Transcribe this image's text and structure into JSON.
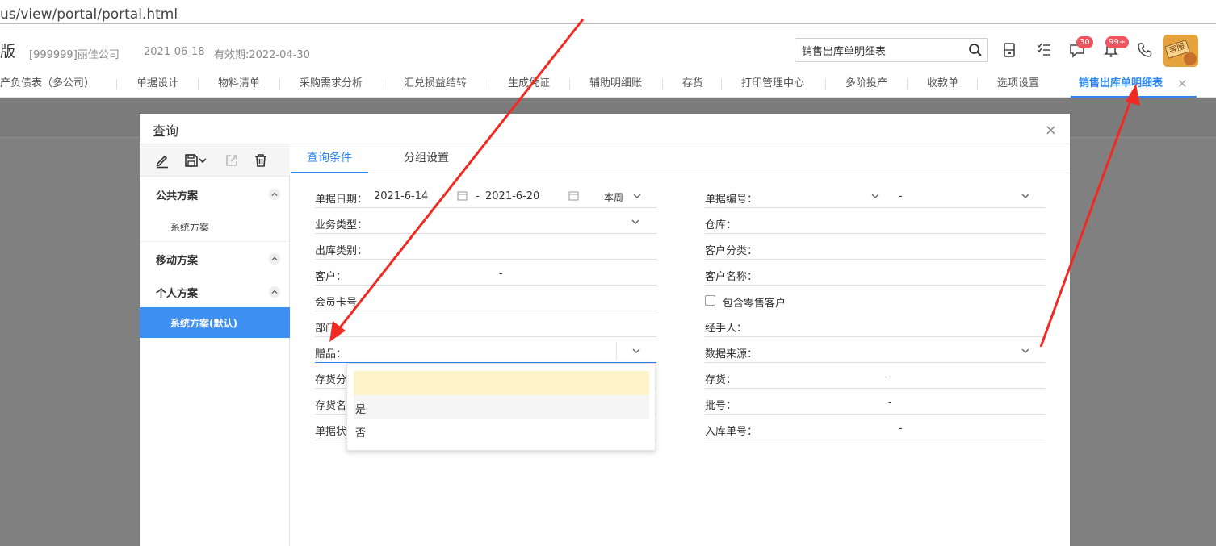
{
  "browser": {
    "url": "us/view/portal/portal.html"
  },
  "header": {
    "brand": "版",
    "company": "[999999]丽佳公司",
    "date": "2021-06-18",
    "valid": "有效期:2022-04-30",
    "search_value": "销售出库单明细表",
    "badge_messages": "30",
    "badge_notifications": "99+",
    "avatar_sign": "客服"
  },
  "tabs": [
    "产负债表（多公司）",
    "单据设计",
    "物料清单",
    "采购需求分析",
    "汇兑损益结转",
    "生成凭证",
    "辅助明细账",
    "存货",
    "打印管理中心",
    "多阶投产",
    "收款单",
    "选项设置",
    "销售出库单明细表"
  ],
  "modal": {
    "title": "查询",
    "left": {
      "groups": {
        "public": "公共方案",
        "mobile": "移动方案",
        "personal": "个人方案"
      },
      "items": {
        "public_system": "系统方案",
        "personal_default": "系统方案(默认)"
      }
    },
    "query_tabs": [
      "查询条件",
      "分组设置"
    ],
    "fields": {
      "doc_date": {
        "label": "单据日期：",
        "from": "2021-6-14",
        "sep": "-",
        "to": "2021-6-20",
        "period": "本周"
      },
      "biz_type": {
        "label": "业务类型："
      },
      "out_category": {
        "label": "出库类别："
      },
      "customer": {
        "label": "客户：",
        "sep": "-"
      },
      "member_card": {
        "label": "会员卡号"
      },
      "department": {
        "label": "部门"
      },
      "gift": {
        "label": "赠品："
      },
      "stock_category": {
        "label": "存货分"
      },
      "stock_name": {
        "label": "存货名"
      },
      "doc_status": {
        "label": "单据状"
      },
      "doc_no": {
        "label": "单据编号：",
        "sep": "-"
      },
      "warehouse": {
        "label": "仓库："
      },
      "customer_class": {
        "label": "客户分类："
      },
      "customer_name": {
        "label": "客户名称："
      },
      "include_retail": {
        "label": "包含零售客户"
      },
      "handler": {
        "label": "经手人："
      },
      "data_source": {
        "label": "数据来源："
      },
      "stock": {
        "label": "存货：",
        "sep": "-"
      },
      "batch": {
        "label": "批号：",
        "sep": "-"
      },
      "in_no": {
        "label": "入库单号：",
        "sep": "-"
      }
    },
    "gift_options": [
      "",
      "是",
      "否"
    ]
  },
  "colors": {
    "accent": "#2d86f0",
    "selected_item_bg": "#3d8ff2",
    "highlight_option": "#fdf3c8",
    "arrow": "#f02a22",
    "badge": "#f0525e"
  }
}
